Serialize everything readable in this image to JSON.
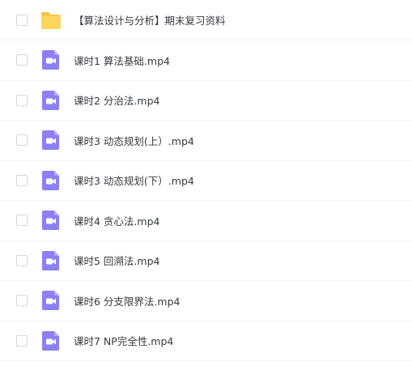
{
  "colors": {
    "folder": "#ffd55c",
    "folder_tab": "#f7c544",
    "video": "#8b80f5",
    "text": "#343a40",
    "divider": "#f1f2f5"
  },
  "files": [
    {
      "name": "【算法设计与分析】期末复习资料",
      "icon": "folder-icon"
    },
    {
      "name": "课时1 算法基础.mp4",
      "icon": "video-file-icon"
    },
    {
      "name": "课时2 分治法.mp4",
      "icon": "video-file-icon"
    },
    {
      "name": "课时3 动态规划(上）.mp4",
      "icon": "video-file-icon"
    },
    {
      "name": "课时3 动态规划(下）.mp4",
      "icon": "video-file-icon"
    },
    {
      "name": "课时4 贪心法.mp4",
      "icon": "video-file-icon"
    },
    {
      "name": "课时5 回溯法.mp4",
      "icon": "video-file-icon"
    },
    {
      "name": "课时6 分支限界法.mp4",
      "icon": "video-file-icon"
    },
    {
      "name": "课时7 NP完全性.mp4",
      "icon": "video-file-icon"
    }
  ]
}
